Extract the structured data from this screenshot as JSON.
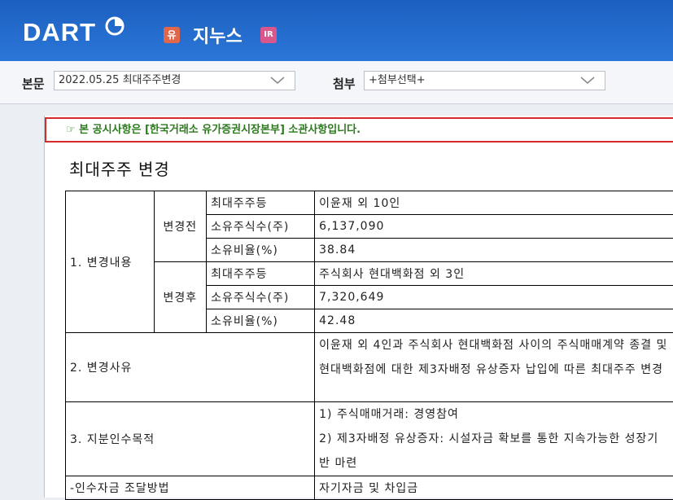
{
  "header": {
    "logo": "DART",
    "company": "지누스",
    "badge_yu": "유",
    "badge_ir": "IR"
  },
  "toolbar": {
    "main_label": "본문",
    "main_select": "2022.05.25  최대주주변경",
    "attach_label": "첨부",
    "attach_select": "+첨부선택+"
  },
  "notice": "☞ 본 공시사항은 [한국거래소 유가증권시장본부] 소관사항입니다.",
  "doc": {
    "title": "최대주주 변경",
    "s1": "1. 변경내용",
    "before": "변경전",
    "after": "변경후",
    "lbl_holder": "최대주주등",
    "lbl_shares": "소유주식수(주)",
    "lbl_ratio": "소유비율(%)",
    "b_holder": "이윤재 외 10인",
    "b_shares": "6,137,090",
    "b_ratio": "38.84",
    "a_holder": "주식회사 현대백화점 외 3인",
    "a_shares": "7,320,649",
    "a_ratio": "42.48",
    "s2": "2. 변경사유",
    "s2_text": "이윤재 외 4인과 주식회사 현대백화점 사이의 주식매매계약 종결 및 현대백화점에 대한 제3자배정 유상증자 납입에 따른 최대주주 변경",
    "s3": "3. 지분인수목적",
    "s3_line1": "1) 주식매매거래: 경영참여",
    "s3_line2": "2) 제3자배정 유상증자: 시설자금 확보를 통한 지속가능한 성장기반 마련",
    "s4": "-인수자금 조달방법",
    "s4_text": "자기자금 및 차입금"
  }
}
